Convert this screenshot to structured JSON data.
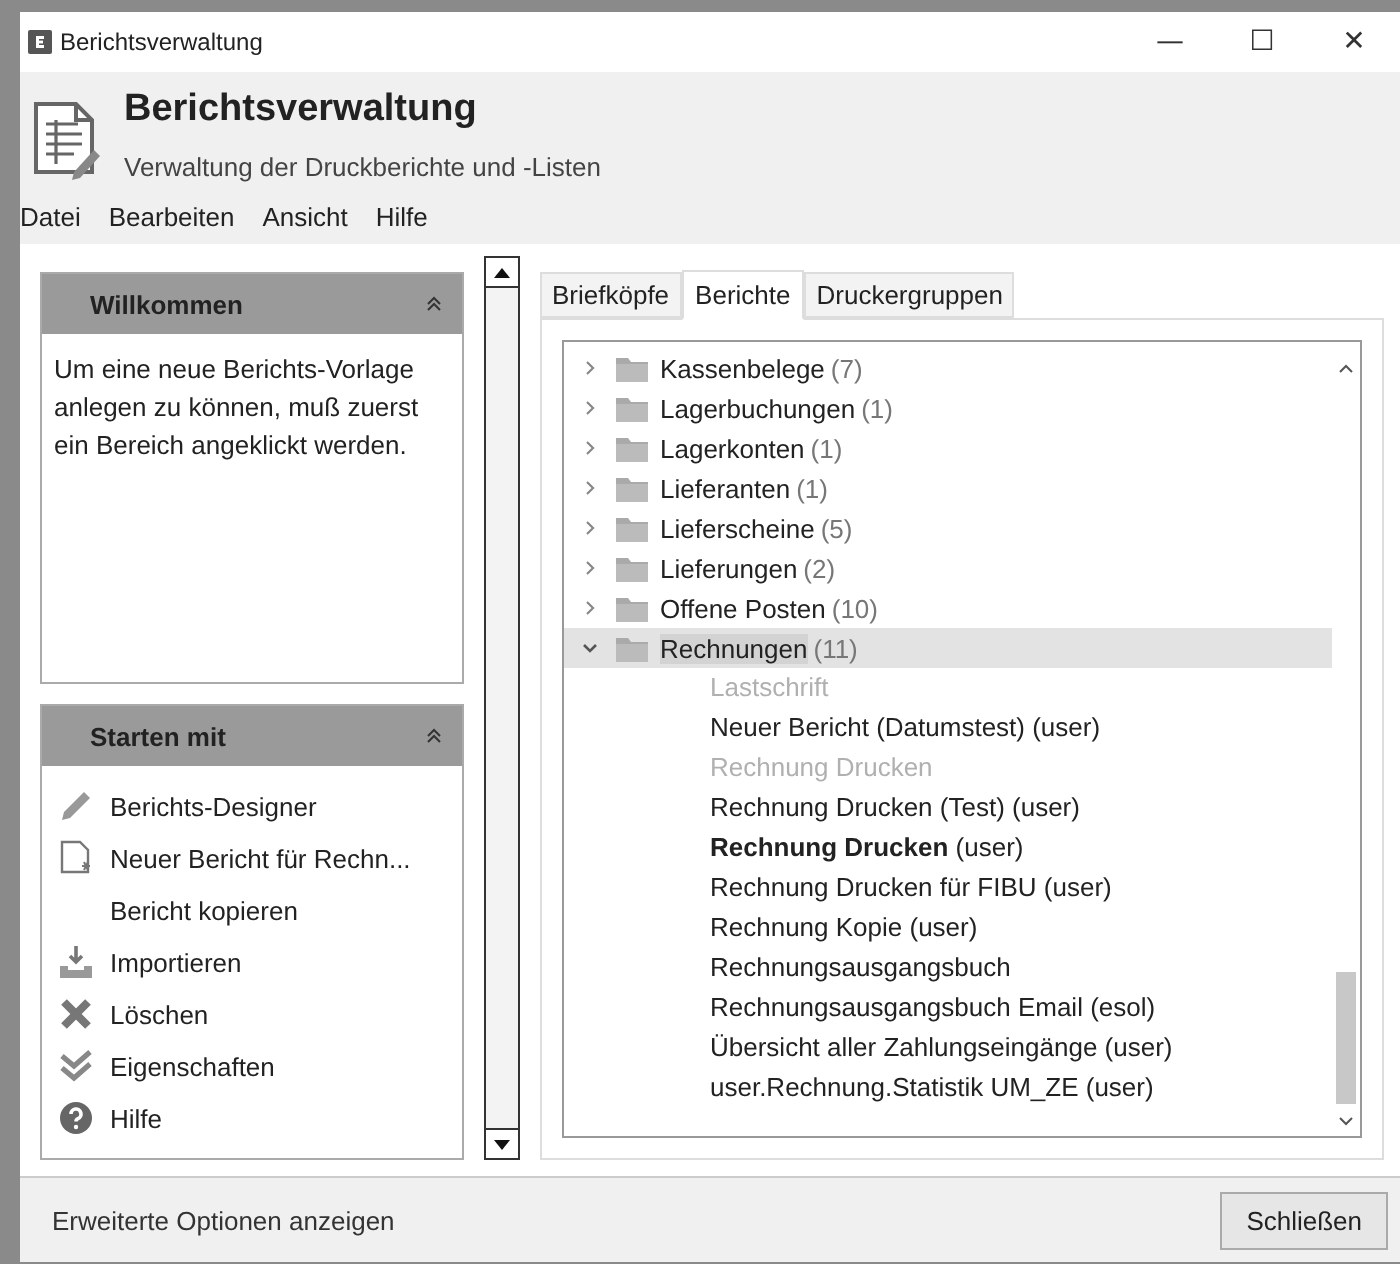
{
  "window": {
    "title": "Berichtsverwaltung",
    "controls": [
      "—",
      "☐",
      "✕"
    ]
  },
  "header": {
    "title": "Berichtsverwaltung",
    "subtitle": "Verwaltung der Druckberichte und -Listen"
  },
  "menu": [
    "Datei",
    "Bearbeiten",
    "Ansicht",
    "Hilfe"
  ],
  "welcome": {
    "title": "Willkommen",
    "expanded": true,
    "text": "Um eine neue Berichts-Vorlage anlegen zu können, muß zuerst ein Bereich angeklickt werden."
  },
  "start": {
    "title": "Starten mit",
    "expanded": true,
    "items": [
      {
        "label": "Berichts-Designer",
        "kind": "pencil"
      },
      {
        "label": "Neuer Bericht für Rechn...",
        "kind": "new"
      },
      {
        "label": "Bericht kopieren",
        "kind": "plain"
      },
      {
        "label": "Importieren",
        "kind": "import"
      },
      {
        "label": "Löschen",
        "kind": "delete"
      },
      {
        "label": "Eigenschaften",
        "kind": "check"
      },
      {
        "label": "Hilfe",
        "kind": "help"
      }
    ]
  },
  "tabs": [
    {
      "label": "Briefköpfe",
      "selected": false
    },
    {
      "label": "Berichte",
      "selected": true
    },
    {
      "label": "Druckergruppen",
      "selected": false
    }
  ],
  "tree": [
    {
      "label": "Kassenbelege",
      "count": "(7)",
      "expanded": false,
      "selected": false
    },
    {
      "label": "Lagerbuchungen",
      "count": "(1)",
      "expanded": false,
      "selected": false
    },
    {
      "label": "Lagerkonten",
      "count": "(1)",
      "expanded": false,
      "selected": false
    },
    {
      "label": "Lieferanten",
      "count": "(1)",
      "expanded": false,
      "selected": false
    },
    {
      "label": "Lieferscheine",
      "count": "(5)",
      "expanded": false,
      "selected": false
    },
    {
      "label": "Lieferungen",
      "count": "(2)",
      "expanded": false,
      "selected": false
    },
    {
      "label": "Offene Posten",
      "count": "(10)",
      "expanded": false,
      "selected": false
    },
    {
      "label": "Rechnungen",
      "count": "(11)",
      "expanded": true,
      "selected": true,
      "children": [
        {
          "label": "Lastschrift",
          "disabled": true
        },
        {
          "label": "Neuer Bericht (Datumstest) (user)",
          "disabled": false
        },
        {
          "label": "Rechnung Drucken",
          "disabled": true
        },
        {
          "label": "Rechnung Drucken (Test) (user)",
          "disabled": false
        },
        {
          "label": "**Rechnung Drucken** (user)",
          "disabled": false
        },
        {
          "label": "Rechnung Drucken für FIBU (user)",
          "disabled": false
        },
        {
          "label": "Rechnung Kopie (user)",
          "disabled": false
        },
        {
          "label": "Rechnungsausgangsbuch",
          "disabled": false
        },
        {
          "label": "Rechnungsausgangsbuch Email (esol)",
          "disabled": false
        },
        {
          "label": "Übersicht aller Zahlungseingänge (user)",
          "disabled": false
        },
        {
          "label": "user.Rechnung.Statistik UM_ZE (user)",
          "disabled": false
        }
      ]
    }
  ],
  "footer": {
    "link": "Erweiterte Optionen anzeigen",
    "button": "Schließen"
  }
}
